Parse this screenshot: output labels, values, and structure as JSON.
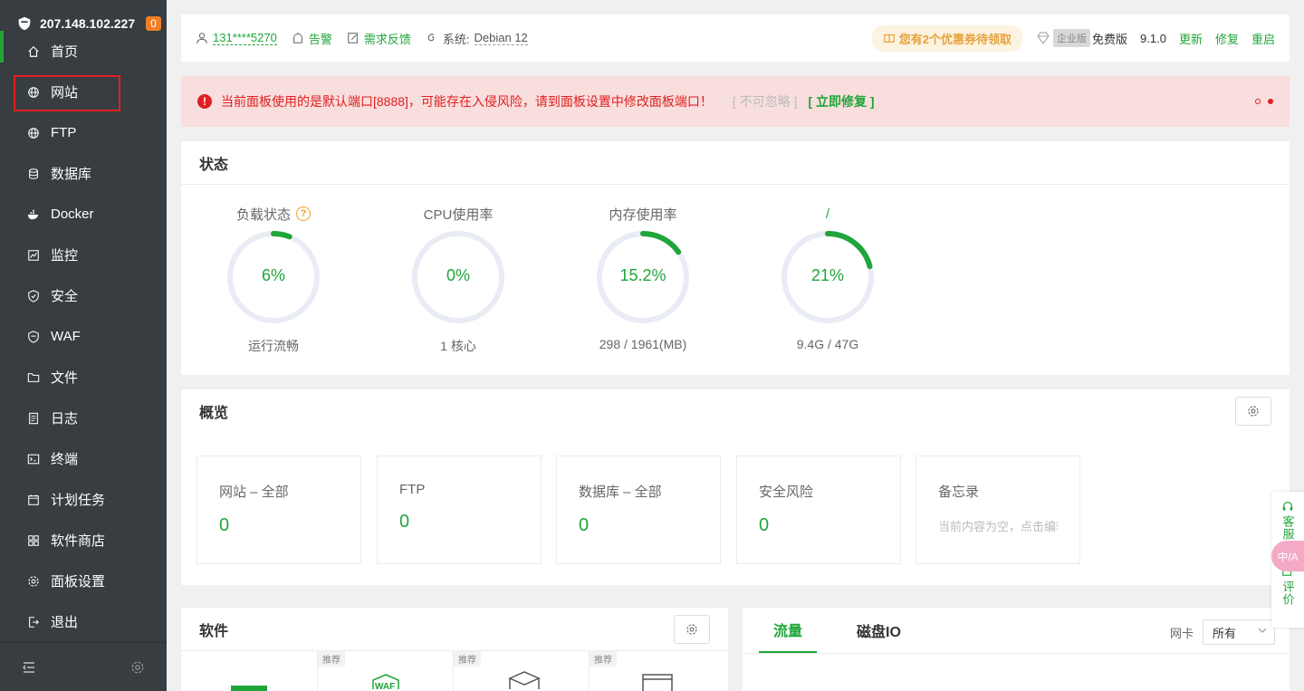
{
  "sidebar": {
    "ip": "207.148.102.227",
    "badge": "0",
    "items": [
      {
        "label": "首页",
        "icon": "home-icon"
      },
      {
        "label": "网站",
        "icon": "globe-icon"
      },
      {
        "label": "FTP",
        "icon": "globe-icon"
      },
      {
        "label": "数据库",
        "icon": "database-icon"
      },
      {
        "label": "Docker",
        "icon": "docker-icon"
      },
      {
        "label": "监控",
        "icon": "monitor-icon"
      },
      {
        "label": "安全",
        "icon": "shield-icon"
      },
      {
        "label": "WAF",
        "icon": "shield-icon"
      },
      {
        "label": "文件",
        "icon": "folder-icon"
      },
      {
        "label": "日志",
        "icon": "log-icon"
      },
      {
        "label": "终端",
        "icon": "terminal-icon"
      },
      {
        "label": "计划任务",
        "icon": "calendar-icon"
      },
      {
        "label": "软件商店",
        "icon": "grid-icon"
      },
      {
        "label": "面板设置",
        "icon": "gear-icon"
      },
      {
        "label": "退出",
        "icon": "logout-icon"
      }
    ]
  },
  "topbar": {
    "user": "131****5270",
    "alarm": "告警",
    "feedback": "需求反馈",
    "system_label": "系统:",
    "system_value": "Debian 12",
    "coupon": "您有2个优惠券待领取",
    "enterprise": "企业版",
    "edition": "免费版",
    "version": "9.1.0",
    "update": "更新",
    "repair": "修复",
    "restart": "重启"
  },
  "alert": {
    "message": "当前面板使用的是默认端口[8888]，可能存在入侵风险，请到面板设置中修改面板端口！",
    "ignore": "[ 不可忽略 ]",
    "fix": "[ 立即修复 ]"
  },
  "status": {
    "title": "状态",
    "gauges": [
      {
        "title": "负载状态",
        "value": "6%",
        "percent": 6,
        "sub": "运行流畅",
        "help": "?"
      },
      {
        "title": "CPU使用率",
        "value": "0%",
        "percent": 0,
        "sub": "1 核心"
      },
      {
        "title": "内存使用率",
        "value": "15.2%",
        "percent": 15.2,
        "sub": "298 / 1961(MB)"
      },
      {
        "title": "/",
        "value": "21%",
        "percent": 21,
        "sub": "9.4G / 47G"
      }
    ]
  },
  "overview": {
    "title": "概览",
    "cards": [
      {
        "label": "网站 – 全部",
        "value": "0"
      },
      {
        "label": "FTP",
        "value": "0"
      },
      {
        "label": "数据库 – 全部",
        "value": "0"
      },
      {
        "label": "安全风险",
        "value": "0"
      }
    ],
    "memo": {
      "label": "备忘录",
      "placeholder": "当前内容为空，点击编辑"
    }
  },
  "software": {
    "title": "软件",
    "recommend": "推荐",
    "waf_label": "WAF"
  },
  "traffic": {
    "tab_traffic": "流量",
    "tab_disk": "磁盘IO",
    "nic_label": "网卡",
    "nic_value": "所有"
  },
  "float": {
    "service": "客服",
    "translate": "中/A",
    "review": "评价"
  },
  "colors": {
    "accent": "#20a53a",
    "danger": "#e02020",
    "sidebar": "#373d41"
  }
}
